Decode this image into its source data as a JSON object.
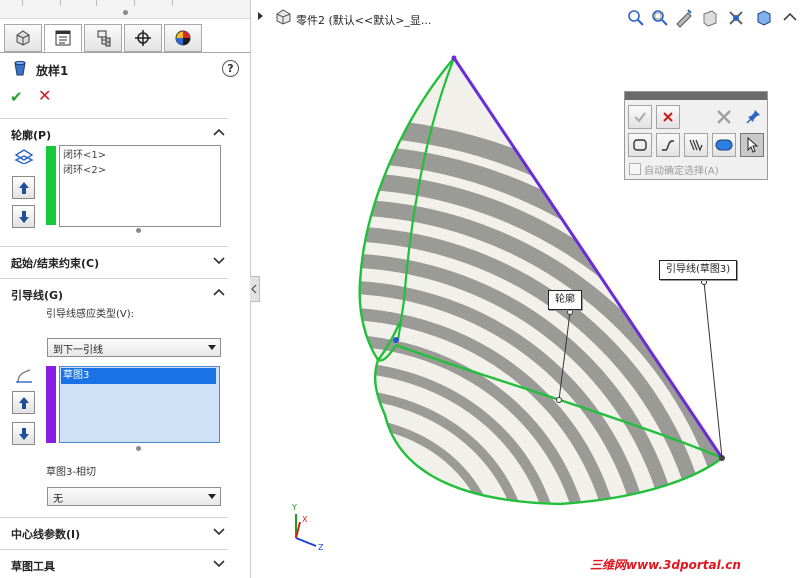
{
  "feature": {
    "title": "放样1",
    "help": "?"
  },
  "pm_tabs": [
    "feature-manager-icon",
    "property-manager-icon",
    "configuration-manager-icon",
    "dimxpert-icon",
    "display-manager-icon"
  ],
  "profiles": {
    "heading": "轮廓(P)",
    "items": [
      "闭环<1>",
      "闭环<2>"
    ],
    "color": "#16c93b"
  },
  "start_end": {
    "heading": "起始/结束约束(C)"
  },
  "guides": {
    "heading": "引导线(G)",
    "influence_label": "引导线感应类型(V):",
    "influence_value": "到下一引线",
    "items": [
      "草图3"
    ],
    "color": "#8a1ee3",
    "tangency_label": "草图3-相切",
    "tangency_value": "无"
  },
  "centerline": {
    "heading": "中心线参数(I)"
  },
  "sketch_tools": {
    "heading": "草图工具"
  },
  "tree": {
    "text": "零件2  (默认<<默认>_显..."
  },
  "selection_toolbar": {
    "auto_label": "自动确定选择(A)"
  },
  "callouts": {
    "profile": "轮廓",
    "guide": "引导线(草图3)"
  },
  "triad": {
    "x": "X",
    "y": "Y",
    "z": "Z"
  },
  "watermark": "三维网www.3dportal.cn",
  "colors": {
    "surface_light": "#f1f0ea",
    "surface_dark": "#9a9a96",
    "profile_edge": "#22bf3b",
    "guide_edge": "#6a2bd8"
  }
}
